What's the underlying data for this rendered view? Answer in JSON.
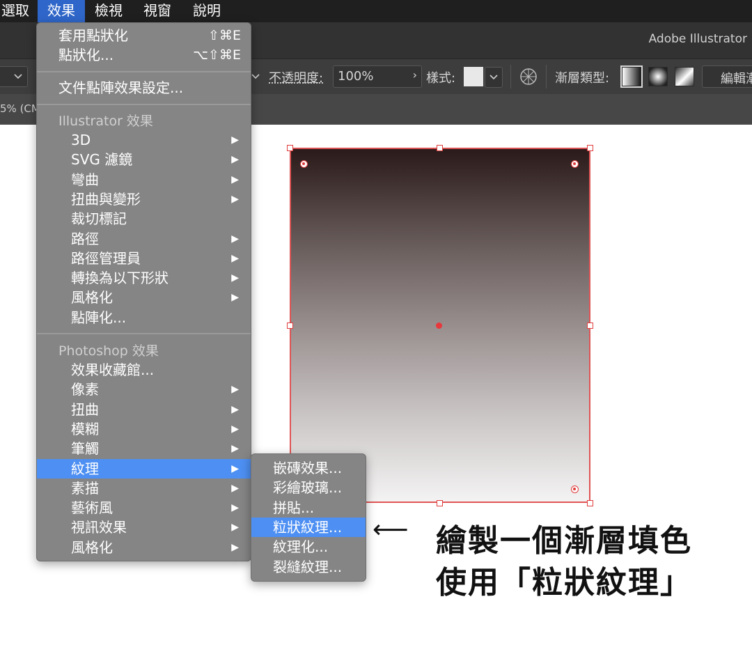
{
  "menubar": {
    "items": [
      {
        "label": "選取",
        "active": false
      },
      {
        "label": "效果",
        "active": true
      },
      {
        "label": "檢視",
        "active": false
      },
      {
        "label": "視窗",
        "active": false
      },
      {
        "label": "說明",
        "active": false
      }
    ]
  },
  "window": {
    "app_title": "Adobe Illustrator"
  },
  "controlbar": {
    "opacity_label": "不透明度:",
    "opacity_value": "100%",
    "style_label": "樣式:",
    "gradient_type_label": "漸層類型:",
    "edit_button_label": "編輯漸"
  },
  "doc_tab": {
    "label": "5% (CM"
  },
  "effect_menu": {
    "apply_item": {
      "label": "套用點狀化",
      "shortcut": "⇧⌘E"
    },
    "last_item": {
      "label": "點狀化...",
      "shortcut": "⌥⇧⌘E"
    },
    "doc_settings": "文件點陣效果設定...",
    "illustrator_header": "Illustrator 效果",
    "illustrator_items": [
      {
        "label": "3D",
        "submenu": true
      },
      {
        "label": "SVG 濾鏡",
        "submenu": true
      },
      {
        "label": "彎曲",
        "submenu": true
      },
      {
        "label": "扭曲與變形",
        "submenu": true
      },
      {
        "label": "裁切標記",
        "submenu": false
      },
      {
        "label": "路徑",
        "submenu": true
      },
      {
        "label": "路徑管理員",
        "submenu": true
      },
      {
        "label": "轉換為以下形狀",
        "submenu": true
      },
      {
        "label": "風格化",
        "submenu": true
      },
      {
        "label": "點陣化...",
        "submenu": false
      }
    ],
    "photoshop_header": "Photoshop 效果",
    "photoshop_items": [
      {
        "label": "效果收藏館...",
        "submenu": false,
        "selected": false
      },
      {
        "label": "像素",
        "submenu": true,
        "selected": false
      },
      {
        "label": "扭曲",
        "submenu": true,
        "selected": false
      },
      {
        "label": "模糊",
        "submenu": true,
        "selected": false
      },
      {
        "label": "筆觸",
        "submenu": true,
        "selected": false
      },
      {
        "label": "紋理",
        "submenu": true,
        "selected": true
      },
      {
        "label": "素描",
        "submenu": true,
        "selected": false
      },
      {
        "label": "藝術風",
        "submenu": true,
        "selected": false
      },
      {
        "label": "視訊效果",
        "submenu": true,
        "selected": false
      },
      {
        "label": "風格化",
        "submenu": true,
        "selected": false
      }
    ],
    "arrow_glyph": "▶"
  },
  "texture_submenu": {
    "items": [
      {
        "label": "嵌磚效果...",
        "selected": false
      },
      {
        "label": "彩繪玻璃...",
        "selected": false
      },
      {
        "label": "拼貼...",
        "selected": false
      },
      {
        "label": "粒狀紋理...",
        "selected": true
      },
      {
        "label": "紋理化...",
        "selected": false
      },
      {
        "label": "裂縫紋理...",
        "selected": false
      }
    ]
  },
  "annotation": {
    "arrow": "⟵",
    "line1": "繪製一個漸層填色",
    "line2": "使用「粒狀紋理」"
  },
  "colors": {
    "menu_highlight": "#4d8ff2",
    "menubar_active": "#2f66c9",
    "selection_red": "#e05454"
  }
}
